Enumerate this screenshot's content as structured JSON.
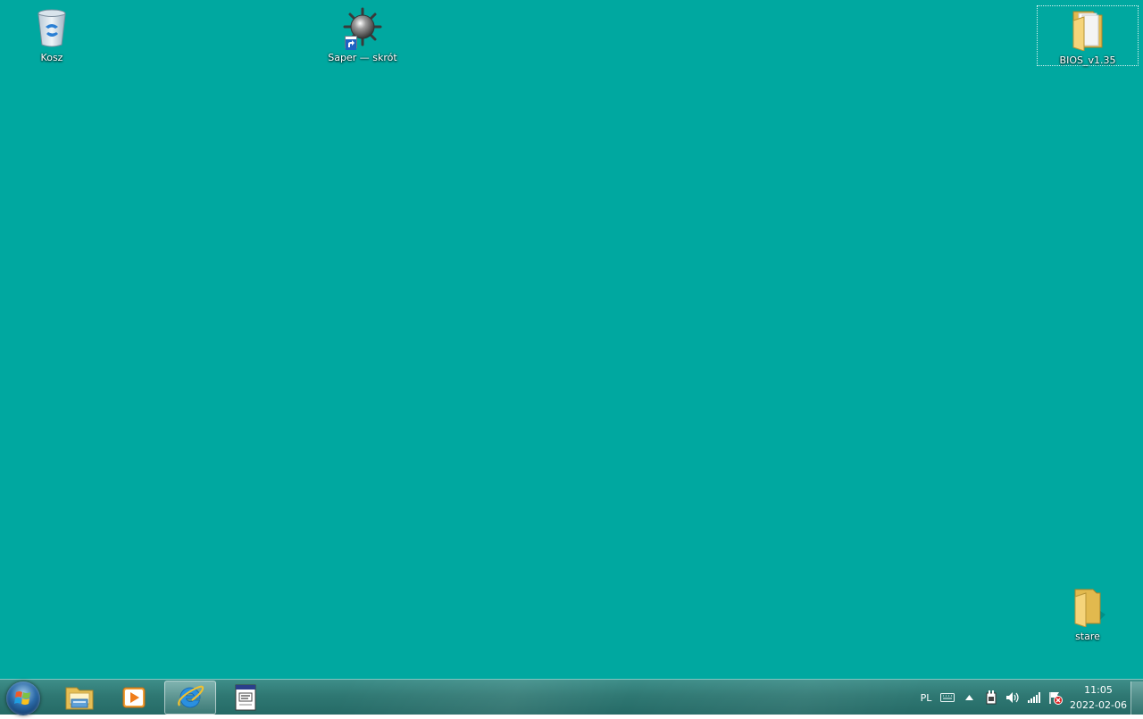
{
  "desktop": {
    "background_color": "#00a8a0",
    "icons": [
      {
        "label": "Kosz",
        "icon": "recycle-bin-icon"
      },
      {
        "label": "Saper — skrót",
        "icon": "minesweeper-icon"
      },
      {
        "label": "BIOS_v1.35",
        "icon": "folder-icon",
        "selected": true
      },
      {
        "label": "stare",
        "icon": "folder-icon"
      }
    ]
  },
  "taskbar": {
    "pinned": [
      {
        "icon": "windows-explorer-icon"
      },
      {
        "icon": "media-player-icon"
      },
      {
        "icon": "internet-explorer-icon",
        "active": true
      },
      {
        "icon": "notepad-document-icon"
      }
    ],
    "tray": {
      "language": "PL",
      "icons": [
        "keyboard-icon",
        "show-hidden-icons-arrow",
        "power-icon",
        "volume-icon",
        "network-signal-icon",
        "action-center-flag-icon"
      ],
      "time": "11:05",
      "date": "2022-02-06"
    }
  }
}
